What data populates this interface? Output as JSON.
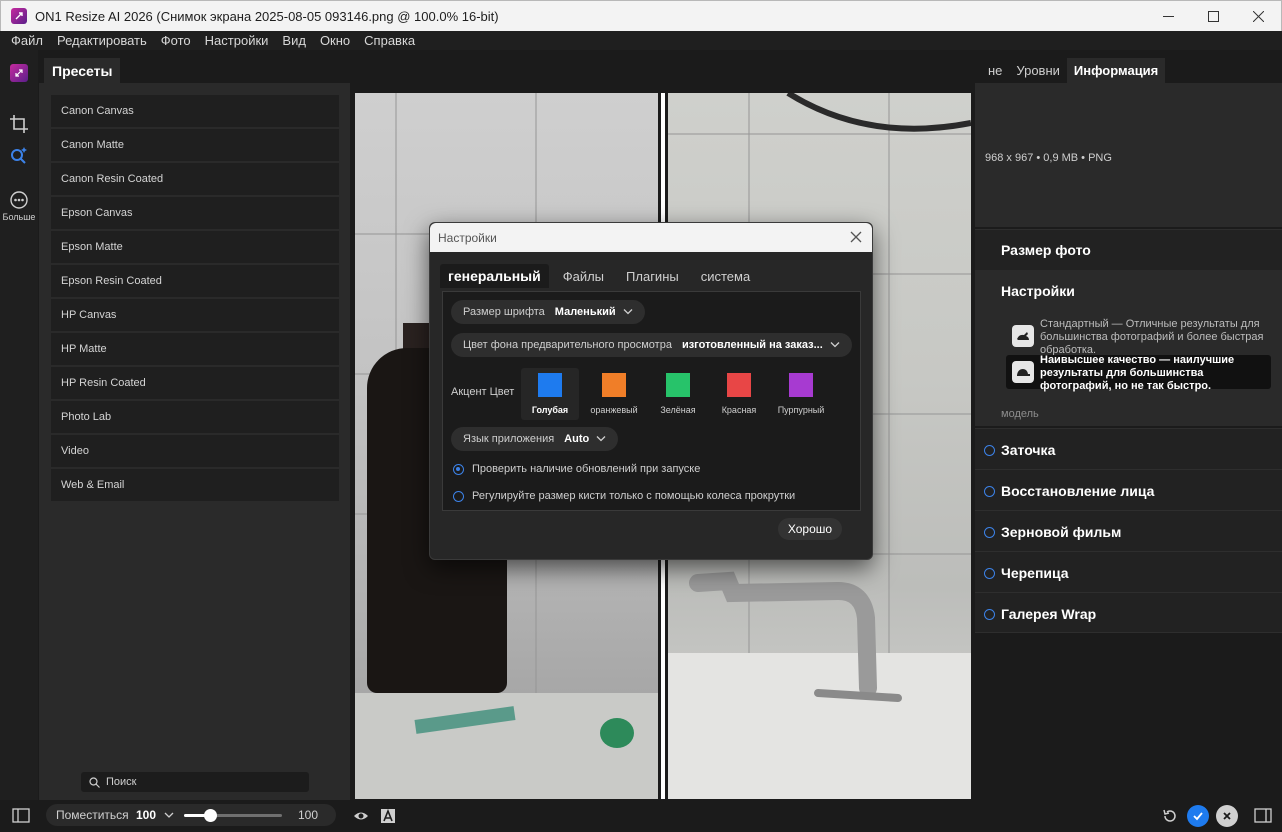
{
  "window": {
    "title": "ON1 Resize AI 2026 (Снимок экрана 2025-08-05 093146.png @ 100.0% 16-bit)"
  },
  "menu": [
    "Файл",
    "Редактировать",
    "Фото",
    "Настройки",
    "Вид",
    "Окно",
    "Справка"
  ],
  "toolbar": {
    "more_label": "Больше"
  },
  "presets": {
    "tab_label": "Пресеты",
    "items": [
      "Canon Canvas",
      "Canon Matte",
      "Canon Resin Coated",
      "Epson Canvas",
      "Epson Matte",
      "Epson Resin Coated",
      "HP Canvas",
      "HP Matte",
      "HP Resin Coated",
      "Photo Lab",
      "Video",
      "Web & Email"
    ],
    "search_placeholder": "Поиск"
  },
  "right_panel": {
    "tabs": [
      "не",
      "Уровни",
      "Информация"
    ],
    "info_text": "968 x 967 • 0,9 MB • PNG",
    "photo_size": "Размер фото",
    "settings_title": "Настройки",
    "option_standard": "Стандартный — Отличные результаты для большинства фотографий и более быстрая обработка.",
    "option_best": "Наивысшее качество — наилучшие результаты для большинства фотографий, но не так быстро.",
    "model_label": "модель",
    "sections": [
      "Заточка",
      "Восстановление лица",
      "Зерновой фильм",
      "Черепица",
      "Галерея Wrap"
    ]
  },
  "bottom": {
    "fit_label": "Поместиться",
    "fit_value": "100",
    "zoom_value": "100",
    "zoom_fraction": 0.27
  },
  "dialog": {
    "title": "Настройки",
    "tabs": [
      "генеральный",
      "Файлы",
      "Плагины",
      "система"
    ],
    "font_size_label": "Размер шрифта",
    "font_size_value": "Маленький",
    "bg_label": "Цвет фона предварительного просмотра",
    "bg_value": "изготовленный на заказ...",
    "accent_label": "Акцент Цвет",
    "accents": [
      {
        "name": "Голубая",
        "color": "#1e7bef"
      },
      {
        "name": "оранжевый",
        "color": "#f07e28"
      },
      {
        "name": "Зелёная",
        "color": "#27c36a"
      },
      {
        "name": "Красная",
        "color": "#e84646"
      },
      {
        "name": "Пурпурный",
        "color": "#a73ad1"
      }
    ],
    "lang_label": "Язык приложения",
    "lang_value": "Auto",
    "check_updates": "Проверить наличие обновлений при запуске",
    "brush_scroll": "Регулируйте размер кисти только с помощью колеса прокрутки",
    "ok_label": "Хорошо"
  },
  "colors": {
    "accent": "#3c82e8"
  }
}
